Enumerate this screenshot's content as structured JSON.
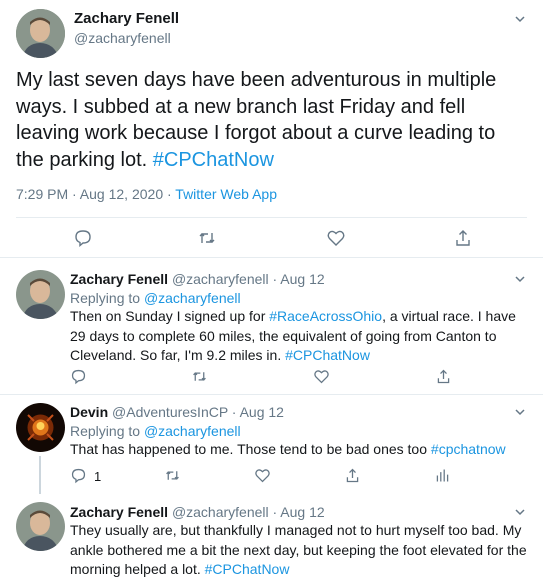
{
  "colors": {
    "accent": "#1b95e0",
    "muted": "#657786",
    "text": "#14171a",
    "divider": "#e6ecf0"
  },
  "main_tweet": {
    "author_name": "Zachary Fenell",
    "author_handle": "@zacharyfenell",
    "text_plain": "My last seven days have been adventurous in multiple ways. I subbed at a new branch last Friday and fell leaving work because I forgot about a curve leading to the parking lot.",
    "hashtag": "#CPChatNow",
    "timestamp": "7:29 PM · Aug 12, 2020 · ",
    "source": "Twitter Web App",
    "actions": [
      "reply-icon",
      "retweet-icon",
      "like-icon",
      "share-icon"
    ]
  },
  "replies": [
    {
      "author_name": "Zachary Fenell",
      "author_handle": "@zacharyfenell",
      "dot_date": " · Aug 12",
      "replying_prefix": "Replying to ",
      "replying_to": "@zacharyfenell",
      "text_1": "Then on Sunday I signed up for ",
      "hashtag_1": "#RaceAcrossOhio",
      "text_2": ", a virtual race. I have 29 days to complete 60 miles, the equivalent of going from Canton to Cleveland. So far, I'm 9.2 miles in. ",
      "hashtag_2": "#CPChatNow"
    },
    {
      "author_name": "Devin",
      "author_handle": "@AdventuresInCP",
      "dot_date": " · Aug 12",
      "replying_prefix": "Replying to ",
      "replying_to": "@zacharyfenell",
      "text_1": "That has happened to me. Those tend to be bad ones too ",
      "hashtag_1": "#cpchatnow",
      "reply_count": "1"
    },
    {
      "author_name": "Zachary Fenell",
      "author_handle": "@zacharyfenell",
      "dot_date": " · Aug 12",
      "text_1": "They usually are, but thankfully I managed not to hurt myself too bad. My ankle bothered me a bit the next day, but keeping the foot elevated for the morning helped a lot. ",
      "hashtag_1": "#CPChatNow"
    }
  ]
}
